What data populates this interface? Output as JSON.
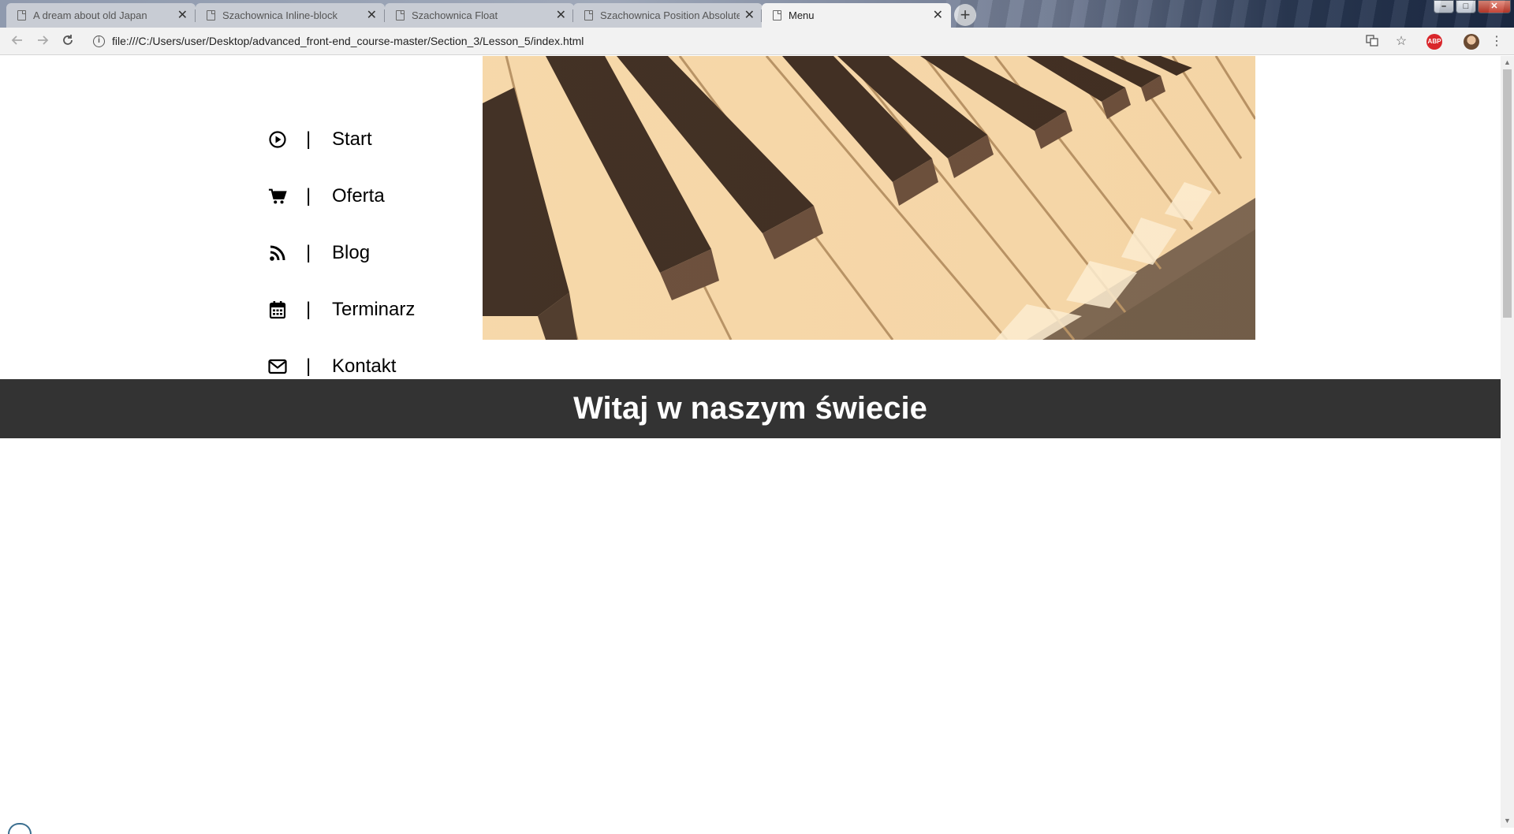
{
  "browser": {
    "tabs": [
      {
        "title": "A dream about old Japan",
        "active": false
      },
      {
        "title": "Szachownica Inline-block",
        "active": false
      },
      {
        "title": "Szachownica Float",
        "active": false
      },
      {
        "title": "Szachownica Position Absolute",
        "active": false
      },
      {
        "title": "Menu",
        "active": true
      }
    ],
    "tab_close_glyph": "✕",
    "new_tab_glyph": "+",
    "window_controls": {
      "minimize": "–",
      "maximize": "□",
      "close": "✕"
    },
    "url": "file:///C:/Users/user/Desktop/advanced_front-end_course-master/Section_3/Lesson_5/index.html",
    "abp_label": "ABP"
  },
  "page": {
    "menu": [
      {
        "label": "Start",
        "icon": "play-circle-icon"
      },
      {
        "label": "Oferta",
        "icon": "shopping-cart-icon"
      },
      {
        "label": "Blog",
        "icon": "rss-icon"
      },
      {
        "label": "Terminarz",
        "icon": "calendar-icon"
      },
      {
        "label": "Kontakt",
        "icon": "envelope-icon"
      }
    ],
    "separator": "|",
    "banner_title": "Witaj w naszym świecie",
    "colors": {
      "banner_bg": "#333333",
      "banner_text": "#ffffff",
      "piano_tone": "#f4d3a4"
    }
  }
}
